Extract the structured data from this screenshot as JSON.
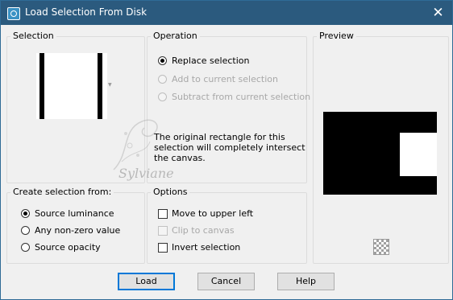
{
  "window": {
    "title": "Load Selection From Disk"
  },
  "selection_group": {
    "label": "Selection"
  },
  "operation_group": {
    "label": "Operation",
    "options": [
      {
        "label": "Replace selection",
        "checked": true,
        "enabled": true
      },
      {
        "label": "Add to current selection",
        "checked": false,
        "enabled": false
      },
      {
        "label": "Subtract from current selection",
        "checked": false,
        "enabled": false
      }
    ],
    "info": "The original rectangle for this selection will completely intersect the canvas."
  },
  "preview_group": {
    "label": "Preview"
  },
  "create_group": {
    "label": "Create selection from:",
    "options": [
      {
        "label": "Source luminance",
        "checked": true
      },
      {
        "label": "Any non-zero value",
        "checked": false
      },
      {
        "label": "Source opacity",
        "checked": false
      }
    ]
  },
  "options_group": {
    "label": "Options",
    "checks": [
      {
        "label": "Move to upper left",
        "checked": false,
        "enabled": true
      },
      {
        "label": "Clip to canvas",
        "checked": false,
        "enabled": false
      },
      {
        "label": "Invert selection",
        "checked": false,
        "enabled": true
      }
    ]
  },
  "buttons": {
    "load": "Load",
    "cancel": "Cancel",
    "help": "Help"
  },
  "watermark": {
    "text": "Sylviane"
  },
  "colors": {
    "titlebar": "#2b5a7e",
    "dialog_bg": "#f0f0f0",
    "default_button_border": "#0078d7"
  }
}
